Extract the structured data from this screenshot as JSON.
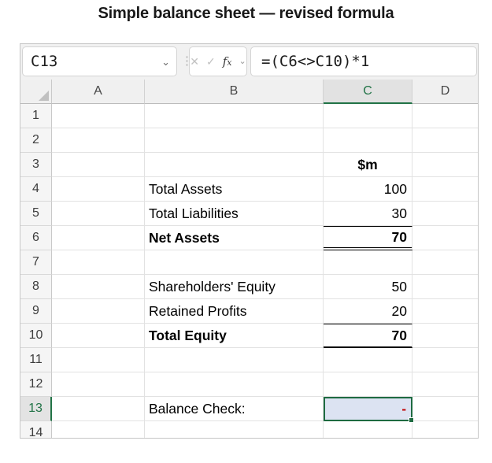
{
  "title": "Simple balance sheet — revised formula",
  "formula_bar": {
    "cell_reference": "C13",
    "formula": "=(C6<>C10)*1",
    "icons": {
      "dropdown": "⌄",
      "separator": "⋮",
      "cancel": "✕",
      "confirm": "✓",
      "fx_f": "f",
      "fx_x": "x"
    }
  },
  "colors": {
    "accent_green": "#217346",
    "selection_border": "#1e6b41",
    "selection_fill": "#dce3f2",
    "negative_red": "#c00000",
    "header_gray": "#f0f0f0"
  },
  "grid": {
    "columns": [
      "A",
      "B",
      "C",
      "D"
    ],
    "selected_column": "C",
    "selected_cell": "C13",
    "rows": [
      {
        "num": "1",
        "b": "",
        "c": ""
      },
      {
        "num": "2",
        "b": "",
        "c": ""
      },
      {
        "num": "3",
        "b": "",
        "c": "$m"
      },
      {
        "num": "4",
        "b": "Total Assets",
        "c": "100"
      },
      {
        "num": "5",
        "b": "Total Liabilities",
        "c": "30"
      },
      {
        "num": "6",
        "b": "Net Assets",
        "c": "70"
      },
      {
        "num": "7",
        "b": "",
        "c": ""
      },
      {
        "num": "8",
        "b": "Shareholders' Equity",
        "c": "50"
      },
      {
        "num": "9",
        "b": "Retained Profits",
        "c": "20"
      },
      {
        "num": "10",
        "b": "Total Equity",
        "c": "70"
      },
      {
        "num": "11",
        "b": "",
        "c": ""
      },
      {
        "num": "12",
        "b": "",
        "c": ""
      },
      {
        "num": "13",
        "b": "Balance Check:",
        "c": "-"
      },
      {
        "num": "14",
        "b": "",
        "c": ""
      }
    ]
  }
}
